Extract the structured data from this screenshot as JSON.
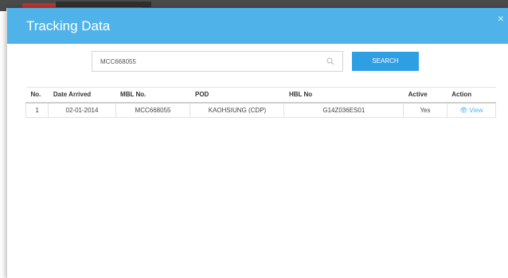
{
  "modal": {
    "title": "Tracking Data",
    "close_icon": "close-icon"
  },
  "search": {
    "value": "MCC668055",
    "placeholder": "",
    "button_label": "SEARCH",
    "icon": "search-icon"
  },
  "table": {
    "headers": {
      "no": "No.",
      "date_arrived": "Date Arrived",
      "mbl_no": "MBL No.",
      "pod": "POD",
      "hbl_no": "HBL No",
      "active": "Active",
      "action": "Action"
    },
    "rows": [
      {
        "no": "1",
        "date_arrived": "02-01-2014",
        "mbl_no": "MCC668055",
        "pod": "KAOHSIUNG (CDP)",
        "hbl_no": "G14Z036ES01",
        "active": "Yes",
        "action_label": "View",
        "action_icon": "eye-icon"
      }
    ]
  },
  "colors": {
    "header_bg": "#4fb3ea",
    "button_bg": "#2f9fe3",
    "link": "#4fb3ea"
  }
}
